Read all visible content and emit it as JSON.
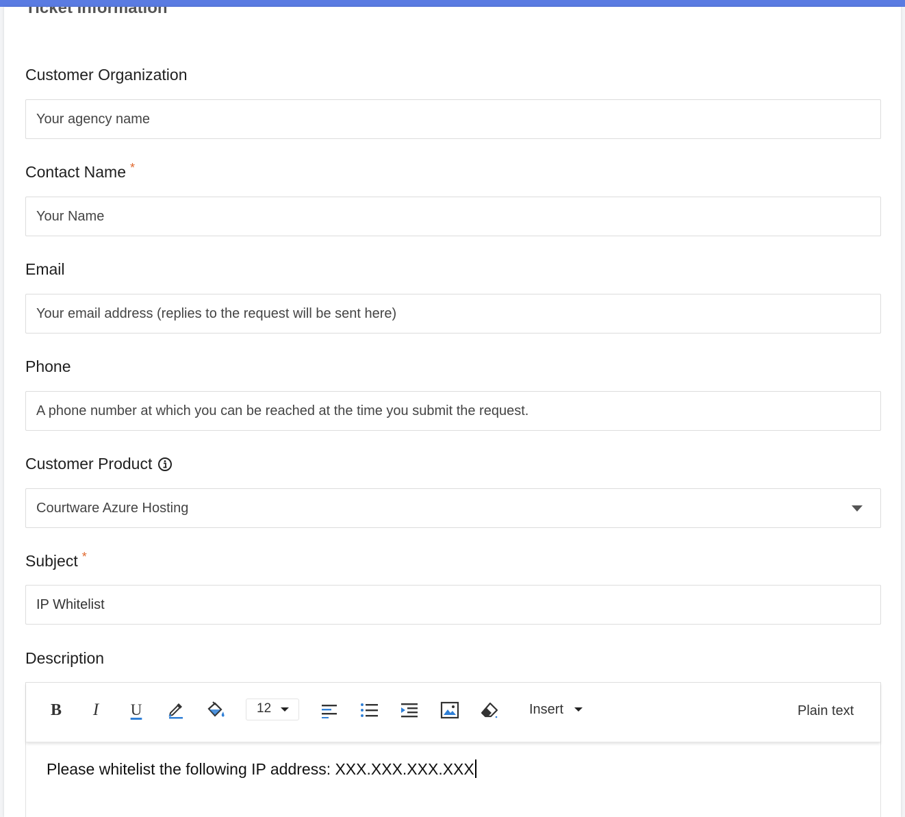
{
  "section": {
    "title": "Ticket Information"
  },
  "fields": {
    "customer_organization": {
      "label": "Customer Organization",
      "placeholder": "Your agency name",
      "value": ""
    },
    "contact_name": {
      "label": "Contact Name",
      "required_mark": "*",
      "placeholder": "Your Name",
      "value": ""
    },
    "email": {
      "label": "Email",
      "placeholder": "Your email address (replies to the request will be sent here)",
      "value": ""
    },
    "phone": {
      "label": "Phone",
      "placeholder": "A phone number at which you can be reached at the time you submit the request.",
      "value": ""
    },
    "customer_product": {
      "label": "Customer Product",
      "selected": "Courtware Azure Hosting",
      "info_icon": "info-circle-icon"
    },
    "subject": {
      "label": "Subject",
      "required_mark": "*",
      "value": "IP Whitelist"
    },
    "description": {
      "label": "Description"
    }
  },
  "editor": {
    "toolbar": {
      "bold": "B",
      "italic": "I",
      "underline": "U",
      "font_size": "12",
      "insert_label": "Insert",
      "plain_text_label": "Plain text",
      "icons": [
        "bold-icon",
        "italic-icon",
        "underline-icon",
        "text-color-icon",
        "background-color-icon",
        "align-left-icon",
        "bulleted-list-icon",
        "indent-icon",
        "image-icon",
        "eraser-icon"
      ]
    },
    "content": "Please whitelist the following IP address: XXX.XXX.XXX.XXX"
  },
  "colors": {
    "accent_bar": "#5a7be2",
    "required": "#e0682e",
    "icon_blue": "#2f7fd6"
  }
}
